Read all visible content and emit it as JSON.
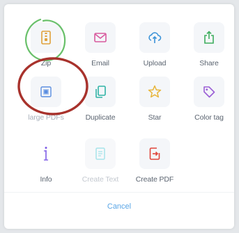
{
  "actions": [
    {
      "label": "Zip",
      "icon": "zip-file-icon",
      "color": "#e0a13a",
      "disabled": false
    },
    {
      "label": "Email",
      "icon": "email-icon",
      "color": "#d85a9e",
      "disabled": false
    },
    {
      "label": "Upload",
      "icon": "cloud-upload-icon",
      "color": "#3b93d8",
      "disabled": false
    },
    {
      "label": "Share",
      "icon": "share-icon",
      "color": "#3eae5e",
      "disabled": false
    },
    {
      "label": "large PDFs",
      "icon": "compress-pdf-icon",
      "color": "#5b8ee0",
      "disabled": false
    },
    {
      "label": "Duplicate",
      "icon": "duplicate-icon",
      "color": "#2fb3a5",
      "disabled": false
    },
    {
      "label": "Star",
      "icon": "star-icon",
      "color": "#e8b53a",
      "disabled": false
    },
    {
      "label": "Color tag",
      "icon": "tag-icon",
      "color": "#9b5fd6",
      "disabled": false
    },
    {
      "label": "Info",
      "icon": "info-icon",
      "color": "#7f5ee6",
      "disabled": false
    },
    {
      "label": "Create Text",
      "icon": "create-text-icon",
      "color": "#a7e4ea",
      "disabled": true
    },
    {
      "label": "Create PDF",
      "icon": "create-pdf-icon",
      "color": "#e0453a",
      "disabled": false
    }
  ],
  "cancel_label": "Cancel",
  "annotations": {
    "green_circle_color": "#69c06a",
    "red_circle_color": "#a8322c"
  }
}
